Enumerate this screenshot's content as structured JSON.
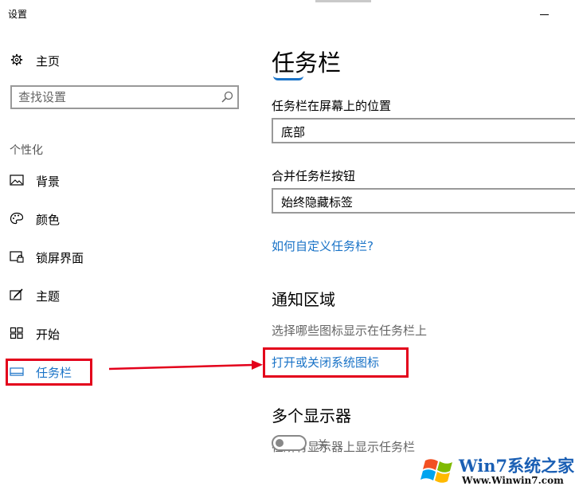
{
  "window": {
    "title": "设置"
  },
  "sidebar": {
    "home_label": "主页",
    "search_placeholder": "查找设置",
    "section_label": "个性化",
    "items": [
      {
        "label": "背景",
        "icon": "picture-icon"
      },
      {
        "label": "颜色",
        "icon": "palette-icon"
      },
      {
        "label": "锁屏界面",
        "icon": "lock-screen-icon"
      },
      {
        "label": "主题",
        "icon": "theme-brush-icon"
      },
      {
        "label": "开始",
        "icon": "start-grid-icon"
      },
      {
        "label": "任务栏",
        "icon": "taskbar-icon",
        "active": true
      }
    ]
  },
  "main": {
    "page_title": "任务栏",
    "position_label": "任务栏在屏幕上的位置",
    "position_value": "底部",
    "combine_label": "合并任务栏按钮",
    "combine_value": "始终隐藏标签",
    "customize_link": "如何自定义任务栏?",
    "notification_header": "通知区域",
    "notification_desc": "选择哪些图标显示在任务栏上",
    "system_icons_link": "打开或关闭系统图标",
    "multi_display_header": "多个显示器",
    "show_all_label": "在所有显示器上显示任务栏",
    "toggle_state": "关"
  },
  "watermark": {
    "brand": "Win7系统之家",
    "url": "Www.Winwin7.com"
  },
  "colors": {
    "accent": "#1a73c7",
    "annotation": "#e3001b"
  }
}
